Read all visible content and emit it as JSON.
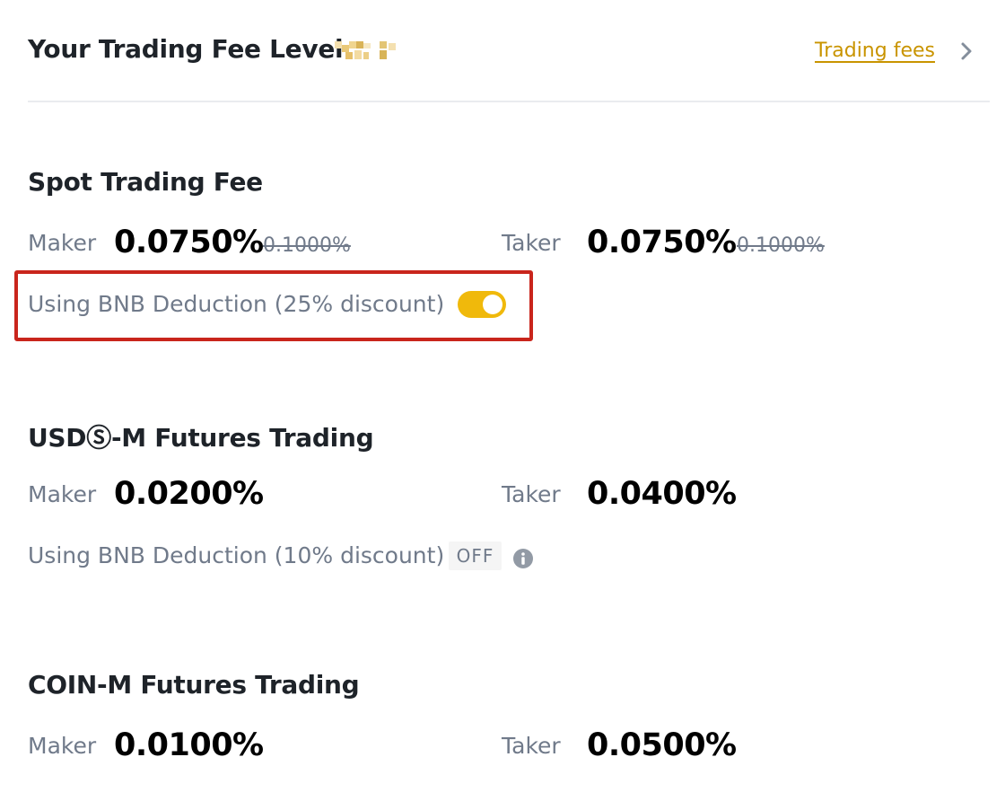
{
  "header": {
    "title": "Your Trading Fee Level",
    "trading_fees_link": "Trading fees"
  },
  "spot": {
    "title": "Spot Trading Fee",
    "maker_label": "Maker",
    "maker_value": "0.0750%",
    "maker_old": "0.1000%",
    "taker_label": "Taker",
    "taker_value": "0.0750%",
    "taker_old": "0.1000%",
    "bnb_text": "Using BNB Deduction (25% discount)",
    "bnb_enabled": true
  },
  "usdm": {
    "title": "USDⓈ-M Futures Trading",
    "maker_label": "Maker",
    "maker_value": "0.0200%",
    "taker_label": "Taker",
    "taker_value": "0.0400%",
    "bnb_text": "Using BNB Deduction (10% discount)",
    "bnb_status": "OFF"
  },
  "coinm": {
    "title": "COIN-M Futures Trading",
    "maker_label": "Maker",
    "maker_value": "0.0100%",
    "taker_label": "Taker",
    "taker_value": "0.0500%"
  },
  "colors": {
    "accent": "#f0b90b",
    "link": "#c99400",
    "highlight_border": "#c9251c",
    "muted_text": "#707a8a"
  },
  "icons": {
    "level_badge": "pixelated-level-badge-icon",
    "chevron": "chevron-right-icon",
    "info": "info-icon"
  }
}
